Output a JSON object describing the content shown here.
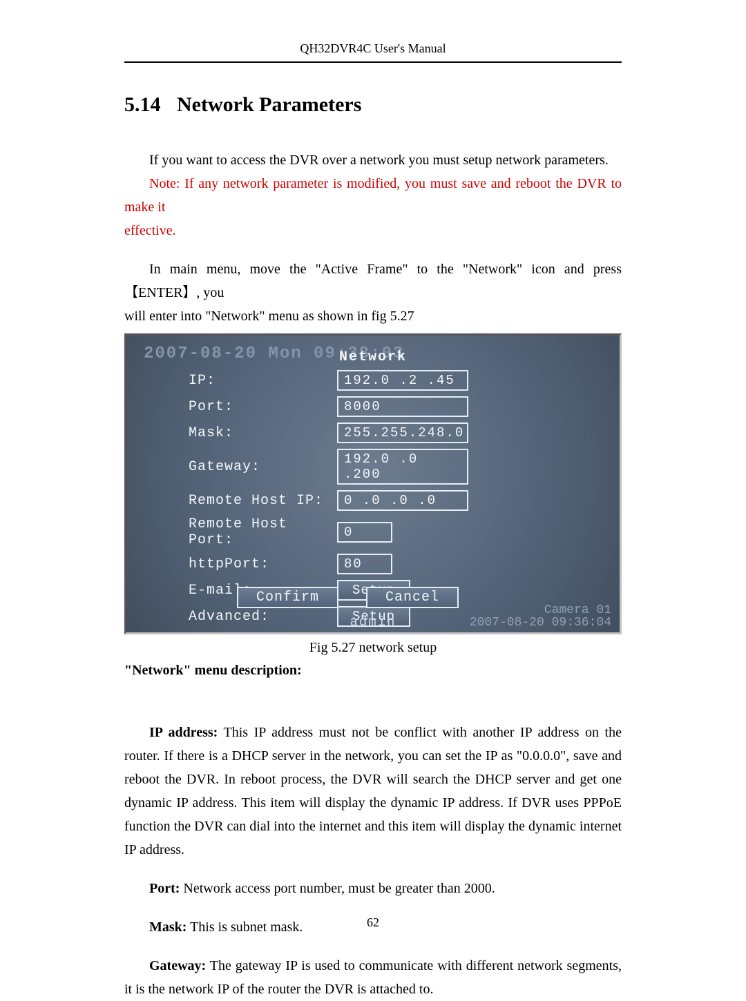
{
  "header": {
    "title": "QH32DVR4C User's Manual"
  },
  "section": {
    "number": "5.14",
    "title": "Network Parameters"
  },
  "intro": {
    "p1": "If you want to access the DVR over a network you must setup network parameters.",
    "note1": "Note: If any network parameter is modified, you must save and reboot the DVR to make it",
    "note2": "effective.",
    "nav1": "In main menu, move the \"Active Frame\" to the \"Network\" icon and press 【ENTER】, you",
    "nav2": "will enter into \"Network\" menu as shown in fig 5.27"
  },
  "dvr": {
    "title": "Network",
    "ghost_time": "2007-08-20 Mon 09:38:03",
    "labels": {
      "ip": "IP:",
      "port": "Port:",
      "mask": "Mask:",
      "gateway": "Gateway:",
      "remote_ip": "Remote Host IP:",
      "remote_port": "Remote Host Port:",
      "http": "httpPort:",
      "email": "E-mail:",
      "advanced": "Advanced:"
    },
    "values": {
      "ip": "192.0  .2  .45",
      "port": "8000",
      "mask": "255.255.248.0",
      "gateway": "192.0  .0  .200",
      "remote_ip": "0  .0  .0  .0",
      "remote_port": "0",
      "http": "80"
    },
    "setup_label": "Setup",
    "confirm": "Confirm",
    "cancel": "Cancel",
    "camera": "Camera 01",
    "footer_time": "2007-08-20 09:36:04",
    "admin": "admin"
  },
  "fig_caption": "Fig 5.27 network setup",
  "desc_heading": "\"Network\" menu description:",
  "desc": {
    "ip_bold": "IP address:",
    "ip_text": " This IP address must not be conflict with another IP address on the router. If there is a DHCP server in the network, you can set the IP as \"0.0.0.0\", save and reboot the DVR. In reboot process, the DVR will search the DHCP server and get one dynamic IP address. This item will display the dynamic IP address. If DVR uses PPPoE function the DVR can dial into the internet and this item will display the dynamic internet IP address.",
    "port_bold": "Port:",
    "port_text": " Network access port number, must be greater than 2000.",
    "mask_bold": "Mask:",
    "mask_text": " This is subnet mask.",
    "gw_bold": "Gateway:",
    "gw_text": " The gateway IP is used to communicate with different network segments, it is the network IP of the router the DVR is attached to."
  },
  "page_number": "62"
}
